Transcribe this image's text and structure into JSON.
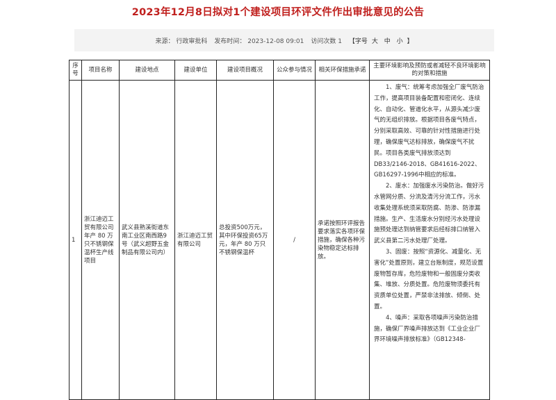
{
  "page": {
    "title": "2023年12月8日拟对1个建设项目环评文件作出审批意见的公告"
  },
  "meta": {
    "source": "来源：  行政审批科",
    "published": "发布时间：  2023-12-08 09:01",
    "views": "访问次数 1",
    "font_size_prefix": "【字号",
    "font_large": "大",
    "font_medium": "中",
    "font_small": "小",
    "font_size_suffix": "】"
  },
  "table": {
    "headers": [
      "序号",
      "项目名称",
      "建设地点",
      "建设单位",
      "建设项目概况",
      "公众参与情况",
      "相关环保措施承诺",
      "主要环境影响及预防或者减轻不良环境影响的对策和措施"
    ],
    "row": {
      "index": "1",
      "name": "浙江迪迈工贸有限公司年产 80 万只不锈钢保温杯生产线项目",
      "location": "武义县熟溪街道东南工业区南西路9号（武义超野五金制品有限公司内）",
      "unit": "浙江迪迈工贸有限公司",
      "overview": "总投资500万元，其中环保投资65万元，年产 80 万只不锈钢保温杯",
      "participation": "/",
      "commitment": "承诺按照环评报告要求落实各项环保措施，确保各种污染物稳定达标排放。",
      "measures": [
        "1、废气：统筹考虑加强全厂废气防治工作，提高项目装备配置和密闭化、连续化、自动化、管道化水平，从源头减少废气的无组织排放。根据项目各废气特点，分别采取高效、可靠的针对性措施进行处理，确保废气达标排放，确保废气不扰民。项目各类废气排放须达到DB33/2146-2018、GB41616-2022、GB16297-1996中相应的标准。",
        "2、废水：加强废水污染防治。做好污水管网分质、分流及清污分流工作，污水收集处理系统须采取防腐、防渗、防渗漏措施。生产、生活废水分别经污水处理设施预处理达到纳管要求后经标排口纳管入武义县第二污水处理厂处理。",
        "3、固废：按照“资源化、减量化、无害化”处置原则，建立台账制度，规范设置废物暂存库，危险废物和一般固废分类收集、堆放、分质处置。危险废物须委托有资质单位处置，严禁非法排放、倾倒、处置。",
        "4、噪声：采取各项噪声污染防治措施，确保厂界噪声排放达到《工业企业厂界环境噪声排放标准》（GB12348-"
      ]
    }
  }
}
